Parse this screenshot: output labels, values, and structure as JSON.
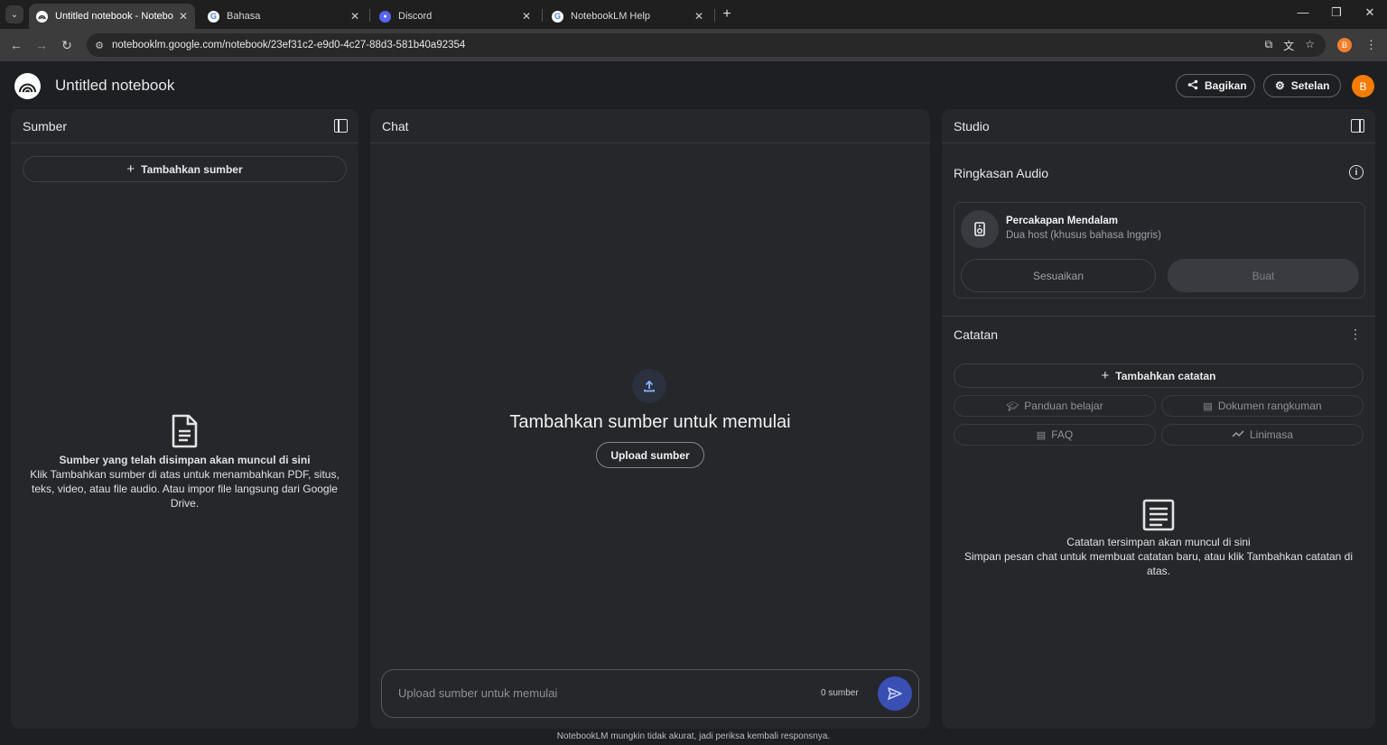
{
  "browser": {
    "tabs": [
      {
        "title": "Untitled notebook - NotebookLM",
        "active": true
      },
      {
        "title": "Bahasa",
        "active": false
      },
      {
        "title": "Discord",
        "active": false
      },
      {
        "title": "NotebookLM Help",
        "active": false
      }
    ],
    "url": "notebooklm.google.com/notebook/23ef31c2-e9d0-4c27-88d3-581b40a92354",
    "profile_initial": "B"
  },
  "header": {
    "title": "Untitled notebook",
    "share_label": "Bagikan",
    "settings_label": "Setelan",
    "avatar_initial": "B"
  },
  "sources": {
    "title": "Sumber",
    "add_label": "Tambahkan sumber",
    "empty_title": "Sumber yang telah disimpan akan muncul di sini",
    "empty_body": "Klik Tambahkan sumber di atas untuk menambahkan PDF, situs, teks, video, atau file audio. Atau impor file langsung dari Google Drive."
  },
  "chat": {
    "title": "Chat",
    "hero": "Tambahkan sumber untuk memulai",
    "upload_label": "Upload sumber",
    "input_placeholder": "Upload sumber untuk memulai",
    "source_count": "0 sumber"
  },
  "studio": {
    "title": "Studio",
    "audio_section": "Ringkasan Audio",
    "audio_card_title": "Percakapan Mendalam",
    "audio_card_desc": "Dua host (khusus bahasa Inggris)",
    "customize_label": "Sesuaikan",
    "generate_label": "Buat",
    "notes_section": "Catatan",
    "add_note_label": "Tambahkan catatan",
    "chips": [
      "Panduan belajar",
      "Dokumen rangkuman",
      "FAQ",
      "Linimasa"
    ],
    "empty_title": "Catatan tersimpan akan muncul di sini",
    "empty_body": "Simpan pesan chat untuk membuat catatan baru, atau klik Tambahkan catatan di atas."
  },
  "footer": "NotebookLM mungkin tidak akurat, jadi periksa kembali responsnya."
}
